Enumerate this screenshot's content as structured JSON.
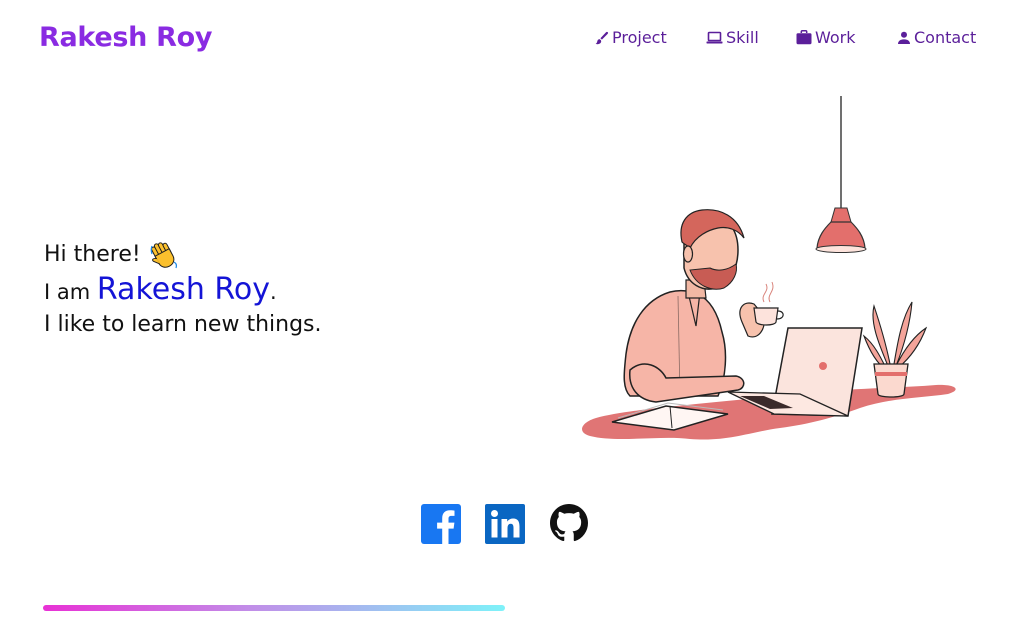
{
  "header": {
    "brand": "Rakesh Roy",
    "nav": [
      {
        "label": "Project",
        "icon": "brush-icon"
      },
      {
        "label": "Skill",
        "icon": "laptop-icon"
      },
      {
        "label": "Work",
        "icon": "briefcase-icon"
      },
      {
        "label": "Contact",
        "icon": "person-icon"
      }
    ]
  },
  "intro": {
    "greeting": "Hi there!",
    "greeting_emoji": "👋",
    "iam_prefix": "I am ",
    "name": "Rakesh Roy",
    "name_suffix": ".",
    "tagline": "I like to learn new things."
  },
  "social": {
    "icons": [
      "facebook-icon",
      "linkedin-icon",
      "github-icon"
    ]
  },
  "progress": {
    "value": 0.45
  },
  "colors": {
    "brand": "#8a2be2",
    "nav": "#5b1f9a",
    "name_accent": "#1414d6"
  }
}
